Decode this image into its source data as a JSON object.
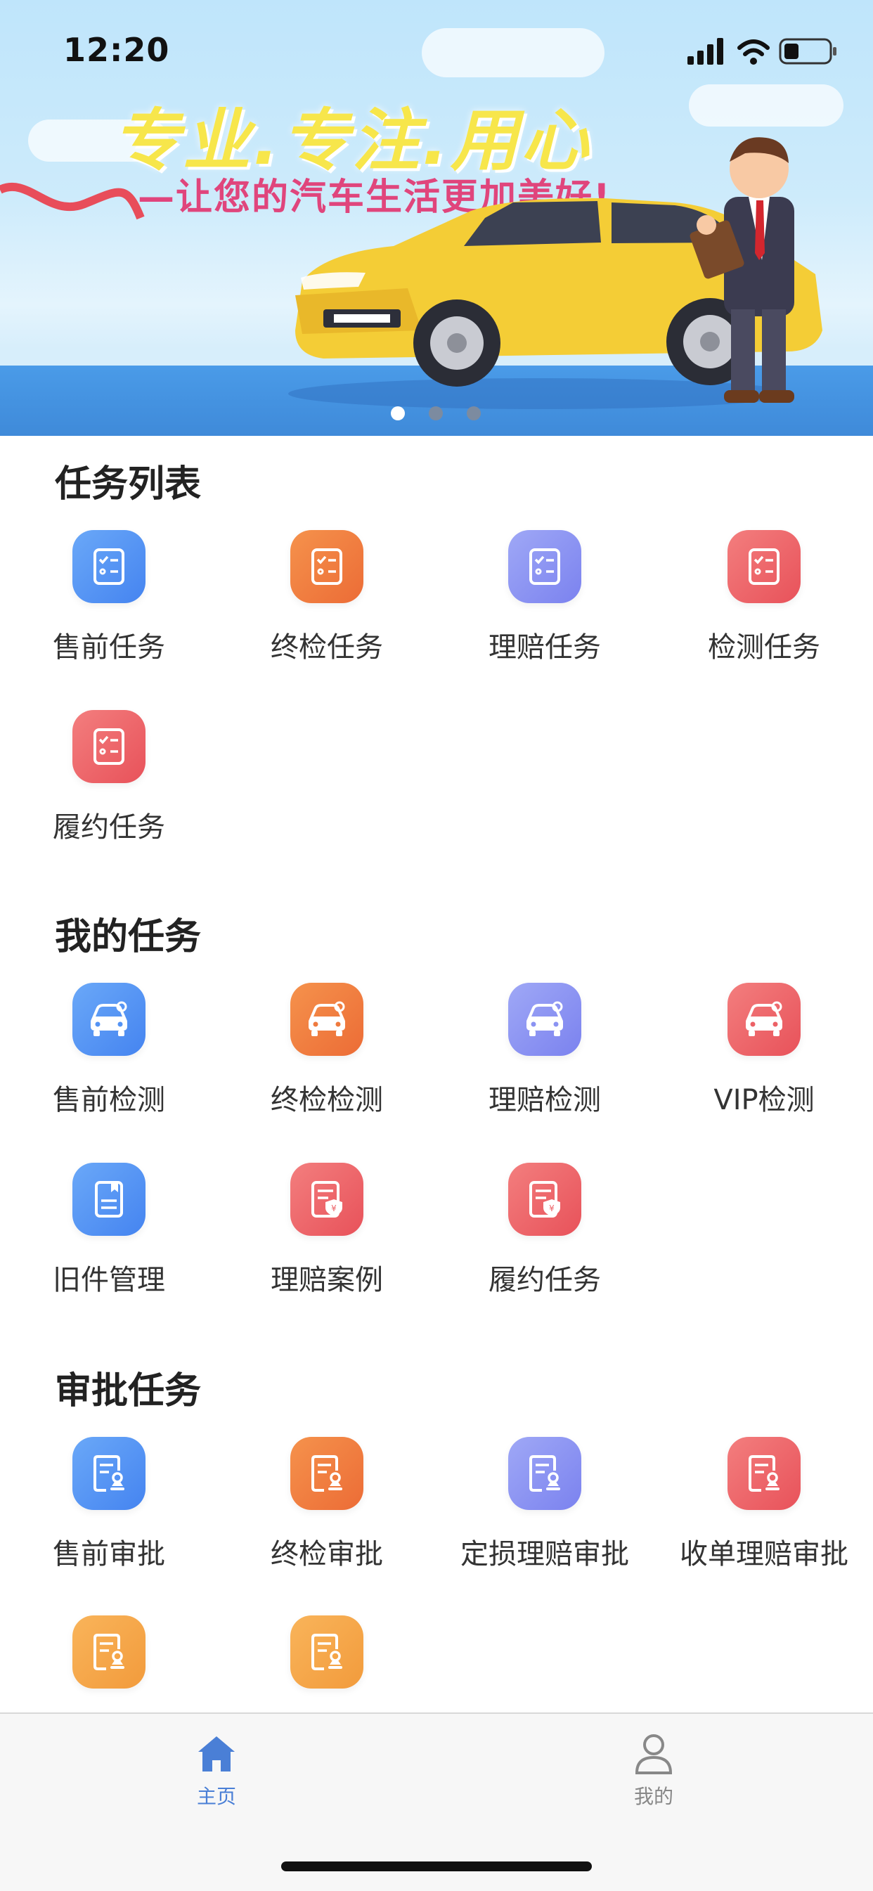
{
  "status_bar": {
    "time": "12:20"
  },
  "banner": {
    "slogan": "专业.专注.用心",
    "subslogan": "—让您的汽车生活更加美好!",
    "page_count": 3,
    "active_page": 1
  },
  "sections": [
    {
      "title": "任务列表",
      "items": [
        {
          "label": "售前任务",
          "icon": "task-list-icon",
          "color": "blue"
        },
        {
          "label": "终检任务",
          "icon": "task-list-icon",
          "color": "orange"
        },
        {
          "label": "理赔任务",
          "icon": "task-list-icon",
          "color": "purple"
        },
        {
          "label": "检测任务",
          "icon": "task-list-icon",
          "color": "red"
        },
        {
          "label": "履约任务",
          "icon": "task-list-icon",
          "color": "red"
        }
      ]
    },
    {
      "title": "我的任务",
      "items": [
        {
          "label": "售前检测",
          "icon": "car-inspect-icon",
          "color": "blue"
        },
        {
          "label": "终检检测",
          "icon": "car-inspect-icon",
          "color": "orange"
        },
        {
          "label": "理赔检测",
          "icon": "car-inspect-icon",
          "color": "purple"
        },
        {
          "label": "VIP检测",
          "icon": "car-inspect-icon",
          "color": "red"
        },
        {
          "label": "旧件管理",
          "icon": "document-icon",
          "color": "blue"
        },
        {
          "label": "理赔案例",
          "icon": "claim-document-icon",
          "color": "red"
        },
        {
          "label": "履约任务",
          "icon": "claim-document-icon",
          "color": "red"
        }
      ]
    },
    {
      "title": "审批任务",
      "items": [
        {
          "label": "售前审批",
          "icon": "approval-stamp-icon",
          "color": "blue"
        },
        {
          "label": "终检审批",
          "icon": "approval-stamp-icon",
          "color": "orange"
        },
        {
          "label": "定损理赔审批",
          "icon": "approval-stamp-icon",
          "color": "purple"
        },
        {
          "label": "收单理赔审批",
          "icon": "approval-stamp-icon",
          "color": "red"
        },
        {
          "label": "",
          "icon": "approval-stamp-icon",
          "color": "amber"
        },
        {
          "label": "",
          "icon": "approval-stamp-icon",
          "color": "amber"
        }
      ]
    }
  ],
  "tab_bar": {
    "tabs": [
      {
        "label": "主页",
        "icon": "home-icon",
        "active": true
      },
      {
        "label": "我的",
        "icon": "person-icon",
        "active": false
      }
    ]
  },
  "colors": {
    "accent": "#4a7fd6",
    "tab_inactive": "#888888",
    "blue": "#5493f4",
    "orange": "#ef7a3e",
    "purple": "#8b93f2",
    "red": "#ec6166",
    "amber": "#f4a547"
  }
}
